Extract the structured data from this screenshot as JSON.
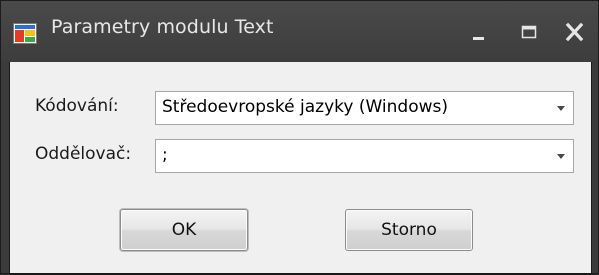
{
  "window": {
    "title": "Parametry modulu Text",
    "icon": "app-window-icon",
    "controls": {
      "minimize_icon": "minimize-icon",
      "maximize_icon": "maximize-icon",
      "close_icon": "close-icon"
    }
  },
  "form": {
    "encoding": {
      "label": "Kódování:",
      "value": "Středoevropské jazyky (Windows)"
    },
    "separator": {
      "label": "Oddělovač:",
      "value": ";"
    }
  },
  "buttons": {
    "ok_label": "OK",
    "cancel_label": "Storno"
  },
  "colors": {
    "titlebar": "#3d3d3d",
    "title_text": "#e8e8e8",
    "client_background": "#f0f0f0"
  }
}
